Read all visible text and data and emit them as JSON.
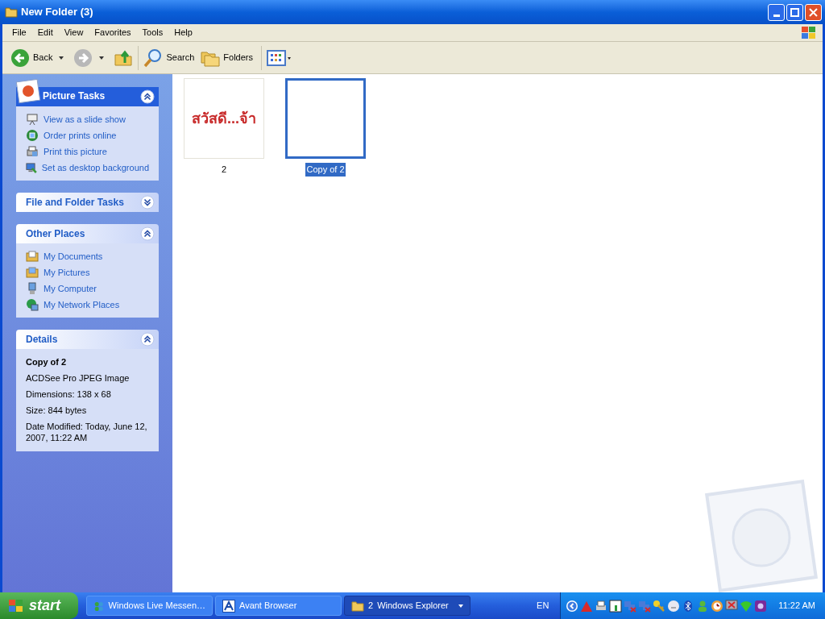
{
  "window": {
    "title": "New Folder (3)"
  },
  "menu": [
    "File",
    "Edit",
    "View",
    "Favorites",
    "Tools",
    "Help"
  ],
  "toolbar": [
    {
      "kind": "back",
      "label": "Back"
    },
    {
      "kind": "forward"
    },
    {
      "kind": "up"
    },
    {
      "kind": "search",
      "label": "Search"
    },
    {
      "kind": "folders",
      "label": "Folders"
    },
    {
      "kind": "views"
    }
  ],
  "task_panels": [
    {
      "kind": "picture",
      "title": "Picture Tasks",
      "expanded": true,
      "items": [
        {
          "kind": "slideshow",
          "label": "View as a slide show"
        },
        {
          "kind": "order",
          "label": "Order prints online"
        },
        {
          "kind": "print",
          "label": "Print this picture"
        },
        {
          "kind": "desktop",
          "label": "Set as desktop background"
        }
      ]
    },
    {
      "kind": "plain",
      "title": "File and Folder Tasks",
      "expanded": false
    },
    {
      "kind": "plain",
      "title": "Other Places",
      "expanded": true,
      "items": [
        {
          "kind": "documents",
          "label": "My Documents"
        },
        {
          "kind": "pictures",
          "label": "My Pictures"
        },
        {
          "kind": "computer",
          "label": "My Computer"
        },
        {
          "kind": "network",
          "label": "My Network Places"
        }
      ]
    },
    {
      "kind": "details",
      "title": "Details",
      "expanded": true,
      "name": "Copy of 2",
      "lines": [
        "ACDSee Pro JPEG Image",
        "Dimensions: 138 x 68",
        "Size: 844 bytes",
        "Date Modified: Today, June 12, 2007, 11:22 AM"
      ]
    }
  ],
  "files": [
    {
      "name": "2",
      "selected": false,
      "preview_text": "สวัสดี...จ้า"
    },
    {
      "name": "Copy of 2",
      "selected": true
    }
  ],
  "taskbar": {
    "start": "start",
    "buttons": [
      {
        "kind": "messenger",
        "label": "Windows Live Messen…",
        "selected": false
      },
      {
        "kind": "browser",
        "label": "Avant Browser",
        "selected": false
      },
      {
        "kind": "folder",
        "count": "2",
        "label": "Windows Explorer",
        "selected": true
      }
    ],
    "language": "EN",
    "clock": "11:22 AM"
  }
}
